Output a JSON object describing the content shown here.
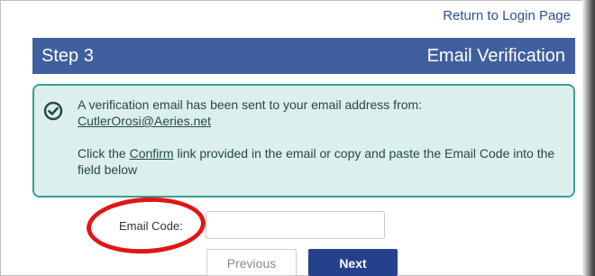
{
  "header": {
    "return_link": "Return to Login Page"
  },
  "step": {
    "label": "Step 3",
    "title": "Email Verification"
  },
  "notice": {
    "icon": "check-circle-icon",
    "line1": "A verification email has been sent to your email address from:",
    "sender_email": "CutlerOrosi@Aeries.net",
    "line2_prefix": "Click the ",
    "confirm_word": "Confirm",
    "line2_suffix": " link provided in the email or copy and paste the Email Code into the field below"
  },
  "form": {
    "code_label": "Email Code:",
    "code_value": ""
  },
  "buttons": {
    "previous": "Previous",
    "next": "Next"
  },
  "colors": {
    "step_bar": "#3f5f9e",
    "notice_bg": "#dcefec",
    "notice_border": "#3a9e93",
    "next_button": "#26418c",
    "annotation_circle": "#e11616"
  }
}
